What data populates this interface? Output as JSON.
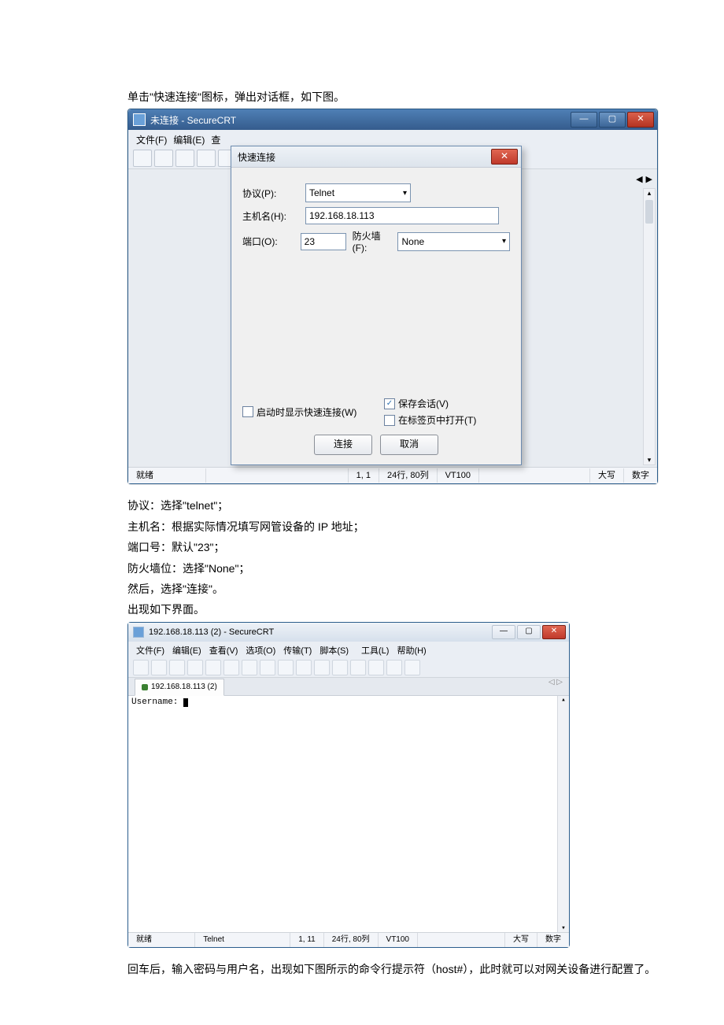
{
  "doc": {
    "intro1": "单击\"快速连接\"图标，弹出对话框，如下图。",
    "notes": [
      "协议：选择\"telnet\"；",
      "主机名：根据实际情况填写网管设备的 IP 地址；",
      "端口号：默认\"23\"；",
      "防火墙位：选择\"None\"；",
      "然后，选择\"连接\"。",
      "出现如下界面。"
    ],
    "outro": "回车后，输入密码与用户名，出现如下图所示的命令行提示符（host#），此时就可以对网关设备进行配置了。"
  },
  "win1": {
    "title": "未连接 - SecureCRT",
    "menus": [
      "文件(F)",
      "编辑(E)",
      "查"
    ],
    "min_icon": "—",
    "max_icon": "▢",
    "close_icon": "✕",
    "nav_left": "◀",
    "nav_right": "▶",
    "status": {
      "ready": "就绪",
      "pos": "1,  1",
      "size": "24行, 80列",
      "term": "VT100",
      "caps": "大写",
      "num": "数字"
    }
  },
  "qc": {
    "title": "快速连接",
    "close": "✕",
    "lab_protocol": "协议(P):",
    "val_protocol": "Telnet",
    "lab_host": "主机名(H):",
    "val_host": "192.168.18.113",
    "lab_port": "端口(O):",
    "val_port": "23",
    "lab_fw": "防火墙(F):",
    "val_fw": "None",
    "chk_start": "启动时显示快速连接(W)",
    "chk_save": "保存会话(V)",
    "chk_tab": "在标签页中打开(T)",
    "btn_connect": "连接",
    "btn_cancel": "取消"
  },
  "win2": {
    "title": "192.168.18.113 (2) - SecureCRT",
    "menus": [
      "文件(F)",
      "编辑(E)",
      "查看(V)",
      "选项(O)",
      "传输(T)",
      "脚本(S)",
      "工具(L)",
      "帮助(H)"
    ],
    "tab": "192.168.18.113 (2)",
    "term_prompt": "Username:",
    "min_icon": "—",
    "max_icon": "▢",
    "close_icon": "✕",
    "nav_left": "◁",
    "nav_right": "▷",
    "status": {
      "ready": "就绪",
      "proto": "Telnet",
      "pos": "1, 11",
      "size": "24行, 80列",
      "term": "VT100",
      "caps": "大写",
      "num": "数字"
    }
  }
}
